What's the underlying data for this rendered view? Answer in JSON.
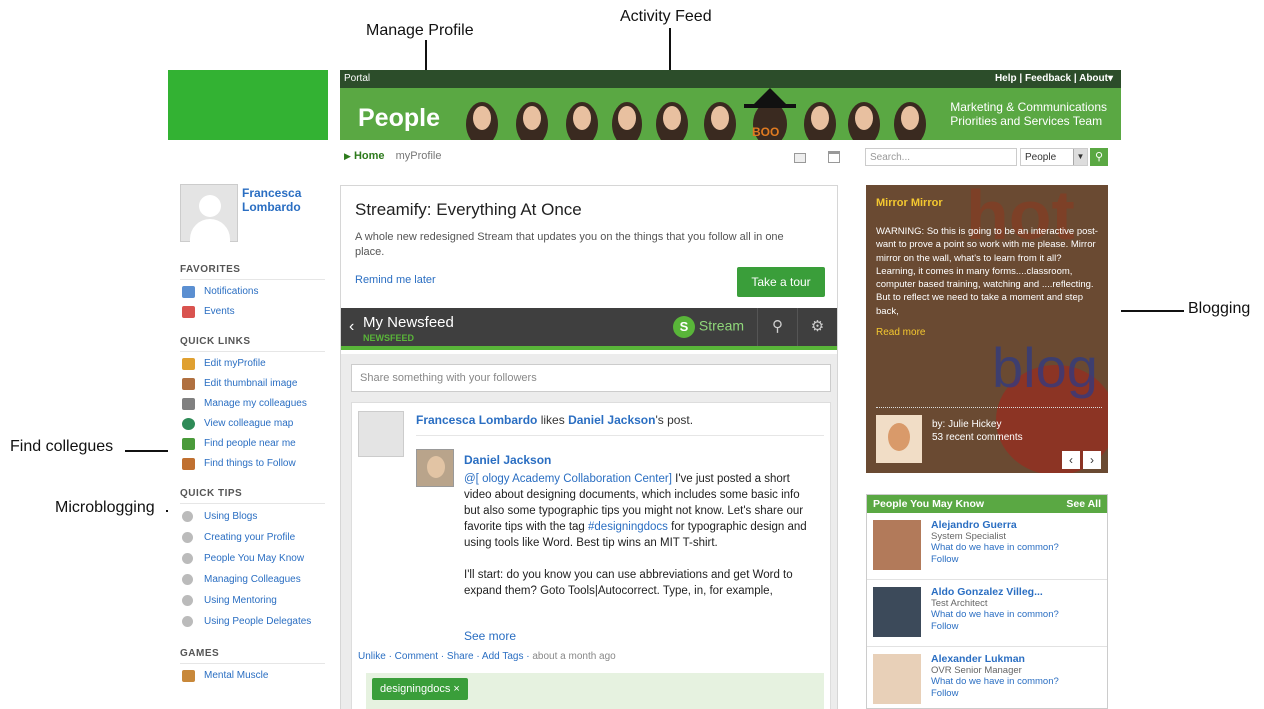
{
  "annotations": {
    "manage_profile": "Manage Profile",
    "activity_feed": "Activity Feed",
    "blogging": "Blogging",
    "find_colleagues": "Find collegues",
    "microblogging": "Microblogging"
  },
  "header": {
    "portal": "Portal",
    "links": "Help | Feedback | About▾",
    "brand": "People",
    "team_line1": "Marketing & Communications",
    "team_line2": "Priorities and Services Team"
  },
  "subnav": {
    "home": "Home",
    "crumb": "myProfile",
    "search_placeholder": "Search...",
    "scope": "People"
  },
  "profile": {
    "first_name": "Francesca",
    "last_name": "Lombardo"
  },
  "sidebar": {
    "favorites_title": "FAVORITES",
    "favorites": [
      {
        "label": "Notifications",
        "color": "#5b8fd1"
      },
      {
        "label": "Events",
        "color": "#d9534f"
      }
    ],
    "quicklinks_title": "QUICK LINKS",
    "quicklinks": [
      {
        "label": "Edit myProfile",
        "color": "#e0a030"
      },
      {
        "label": "Edit thumbnail image",
        "color": "#b07040"
      },
      {
        "label": "Manage my colleagues",
        "color": "#808080"
      },
      {
        "label": "View colleague map",
        "color": "#2e8b57"
      },
      {
        "label": "Find people near me",
        "color": "#4a9a3a"
      },
      {
        "label": "Find things to Follow",
        "color": "#c07030"
      }
    ],
    "quicktips_title": "QUICK TIPS",
    "quicktips": [
      {
        "label": "Using Blogs"
      },
      {
        "label": "Creating your Profile"
      },
      {
        "label": "People You May Know"
      },
      {
        "label": "Managing Colleagues"
      },
      {
        "label": "Using Mentoring"
      },
      {
        "label": "Using People Delegates"
      }
    ],
    "games_title": "GAMES",
    "games": [
      {
        "label": "Mental Muscle"
      }
    ]
  },
  "promo": {
    "title": "Streamify: Everything At Once",
    "text": "A whole new redesigned Stream that updates you on the things that you follow all in one place.",
    "remind": "Remind me later",
    "tour": "Take a tour"
  },
  "newsfeed": {
    "title": "My Newsfeed",
    "subtitle": "NEWSFEED",
    "stream": "Stream",
    "share_placeholder": "Share something with your followers"
  },
  "post": {
    "actor": "Francesca Lombardo",
    "verb": "likes",
    "target": "Daniel Jackson",
    "suffix": "'s post.",
    "author": "Daniel Jackson",
    "mention": "@[                              ology Academy Collaboration Center]",
    "text1": "I've just posted a short video about designing documents, which includes some basic info but also some typographic tips you might not know. Let's share our favorite tips with the tag",
    "hashtag": "#designingdocs",
    "text2": "for typographic design and using tools like Word. Best tip wins an MIT T-shirt.",
    "text3": "I'll start: do you know you can use abbreviations and get Word to expand them? Goto Tools|Autocorrect. Type, in, for example,",
    "see_more": "See more",
    "actions": "Unlike · Comment · Share · Add Tags ·",
    "time": "about a month ago",
    "tag": "designingdocs ×"
  },
  "blog": {
    "title": "Mirror Mirror",
    "text": "WARNING:  So this is going to be an interactive post- want to prove a point so work with me please. Mirror mirror on the wall, what's to learn from it all? Learning, it comes in many forms....classroom, computer based training, watching and ....reflecting.  But to reflect we need to take a moment and step back,",
    "read_more": "Read more",
    "bg_word1": "hot",
    "bg_word2": "blog",
    "by": "by: Julie Hickey",
    "comments": "53 recent comments",
    "prev": "‹",
    "next": "›"
  },
  "pymk": {
    "title": "People You May Know",
    "see_all": "See All",
    "people": [
      {
        "name": "Alejandro Guerra",
        "role": "System Specialist",
        "common": "What do we have in common?",
        "follow": "Follow"
      },
      {
        "name": "Aldo Gonzalez Villeg...",
        "role": "Test Architect",
        "common": "What do we have in common?",
        "follow": "Follow"
      },
      {
        "name": "Alexander Lukman",
        "role": "OVR Senior Manager",
        "common": "What do we have in common?",
        "follow": "Follow"
      }
    ]
  }
}
